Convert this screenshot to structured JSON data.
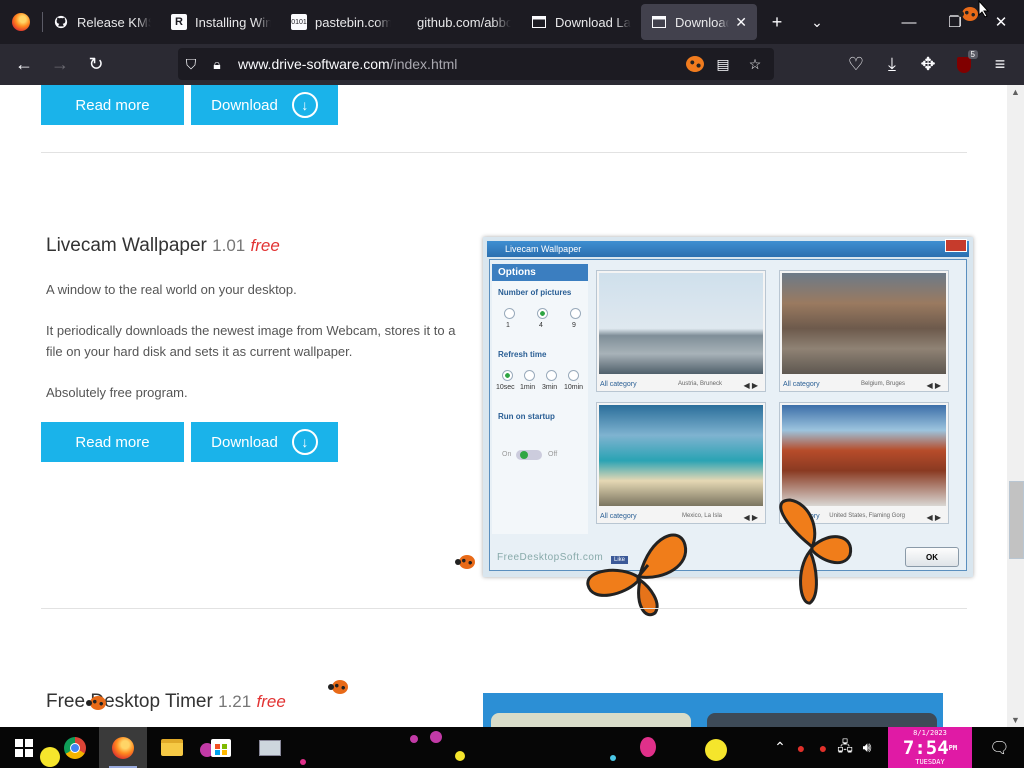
{
  "browser": {
    "tabs": [
      {
        "label": "Release KMSp",
        "icon": "github-icon"
      },
      {
        "label": "Installing Wind",
        "icon": "r-icon"
      },
      {
        "label": "pastebin.com/",
        "icon": "pastebin-icon"
      },
      {
        "label": "github.com/abbo",
        "icon": "none"
      },
      {
        "label": "Download Lad",
        "icon": "film-icon"
      },
      {
        "label": "Download A",
        "icon": "film-icon",
        "active": true
      }
    ],
    "url_domain": "www.drive-software.com",
    "url_path": "/index.html",
    "extension_badge": "5"
  },
  "page": {
    "top_buttons": {
      "read_more": "Read more",
      "download": "Download"
    },
    "product": {
      "name": "Livecam Wallpaper",
      "version": "1.01",
      "price": "free",
      "paragraphs": [
        "A window to the real world on your desktop.",
        "It periodically downloads the newest image from Webcam, stores it to a file on your hard disk and sets it as current wallpaper.",
        "Absolutely free program."
      ],
      "read_more": "Read more",
      "download": "Download"
    },
    "app_shot": {
      "window_title": "Livecam Wallpaper",
      "options_header": "Options",
      "number_label": "Number of pictures",
      "number_options": [
        "1",
        "4",
        "9"
      ],
      "refresh_label": "Refresh time",
      "refresh_options": [
        "10sec",
        "1min",
        "3min",
        "10min"
      ],
      "startup_label": "Run on startup",
      "toggle_on": "On",
      "toggle_off": "Off",
      "thumbs": [
        {
          "category": "All category",
          "location": "Austria, Bruneck"
        },
        {
          "category": "All category",
          "location": "Belgium, Bruges"
        },
        {
          "category": "All category",
          "location": "Mexico, La Isla"
        },
        {
          "category": "All category",
          "location": "United States, Flaming Gorg"
        }
      ],
      "footer_brand": "FreeDesktopSoft.com",
      "like_label": "Like",
      "ok_label": "OK"
    },
    "next_product": {
      "name": "Free Desktop Timer",
      "version": "1.21",
      "price": "free"
    }
  },
  "taskbar": {
    "clock_date": "8/1/2023",
    "clock_time": "7:54",
    "clock_ampm": "PM",
    "clock_day": "TUESDAY"
  },
  "colors": {
    "accent_button": "#1ab3ea",
    "free_text": "#e23232",
    "clock_bg": "#e01aa5"
  }
}
